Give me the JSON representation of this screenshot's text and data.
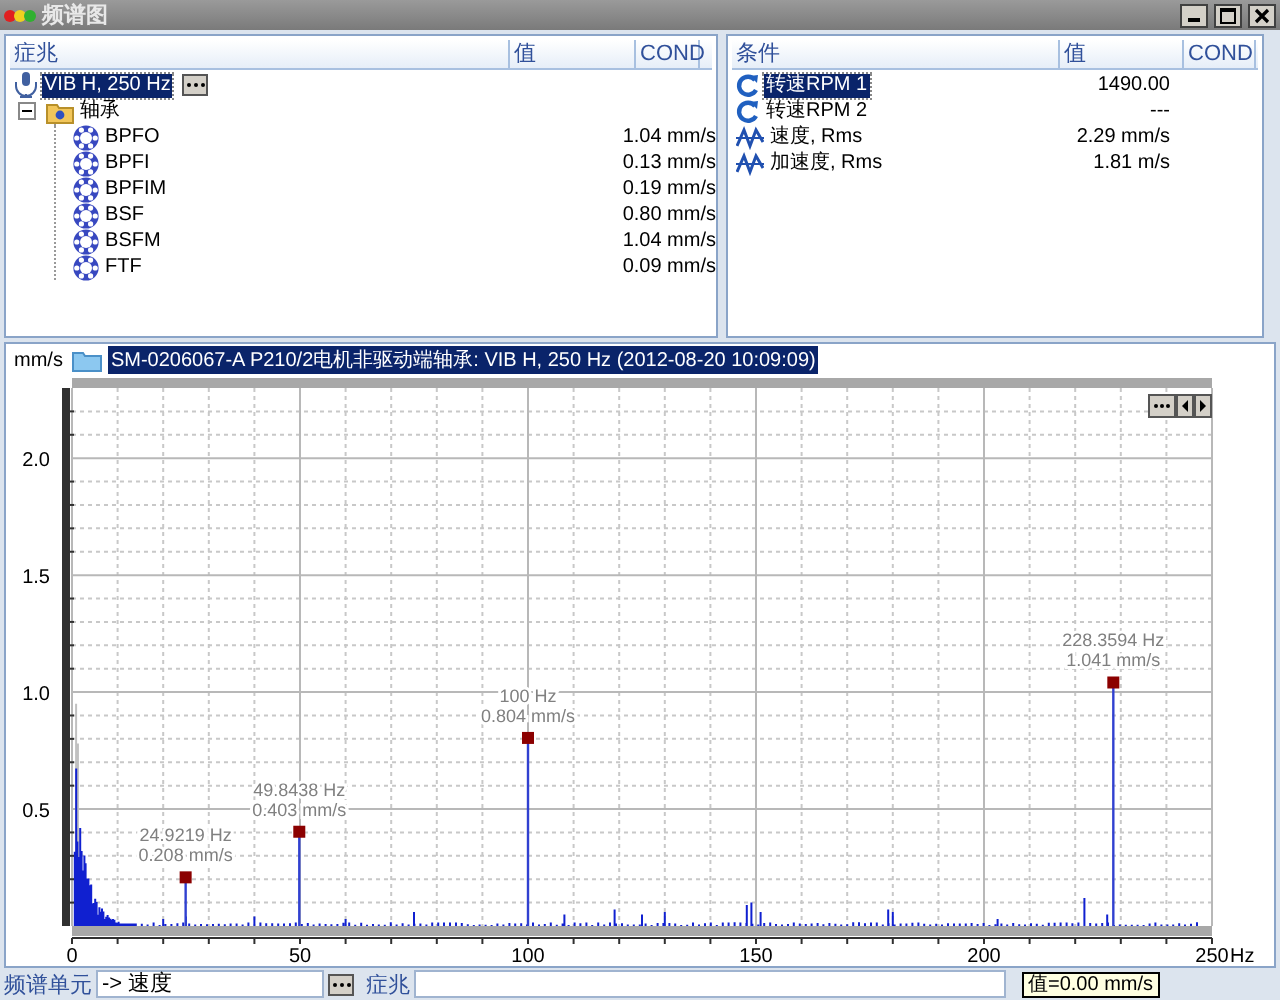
{
  "window": {
    "title": "频谱图"
  },
  "symptoms_panel": {
    "columns": [
      "症兆",
      "值",
      "COND"
    ],
    "root": {
      "label": "VIB H, 250 Hz",
      "selected": true,
      "children": [
        {
          "label": "轴承",
          "expanded": true,
          "children": [
            {
              "label": "BPFO",
              "value": "1.04 mm/s"
            },
            {
              "label": "BPFI",
              "value": "0.13 mm/s"
            },
            {
              "label": "BPFIM",
              "value": "0.19 mm/s"
            },
            {
              "label": "BSF",
              "value": "0.80 mm/s"
            },
            {
              "label": "BSFM",
              "value": "1.04 mm/s"
            },
            {
              "label": "FTF",
              "value": "0.09 mm/s"
            }
          ]
        }
      ]
    }
  },
  "conditions_panel": {
    "columns": [
      "条件",
      "值",
      "COND"
    ],
    "rows": [
      {
        "kind": "rpm",
        "label": "转速RPM 1",
        "value": "1490.00",
        "selected": true
      },
      {
        "kind": "rpm",
        "label": "转速RPM 2",
        "value": "---",
        "selected": false
      },
      {
        "kind": "wave",
        "label": "速度, Rms",
        "value": "2.29 mm/s",
        "selected": false
      },
      {
        "kind": "wave",
        "label": "加速度, Rms",
        "value": "1.81 m/s",
        "selected": false
      }
    ]
  },
  "spectrum": {
    "unit": "mm/s",
    "title": "SM-0206067-A  P210/2电机非驱动端轴承: VIB H, 250 Hz (2012-08-20 10:09:09)",
    "chart_data": {
      "type": "scatter",
      "grid": true,
      "xlabel": "Hz",
      "x": [
        24.9219,
        49.8438,
        100,
        228.3594
      ],
      "values": [
        0.208,
        0.403,
        0.804,
        1.041
      ],
      "xlim": [
        0,
        250
      ],
      "ylim": [
        0,
        2.3
      ],
      "xticks": [
        0,
        50,
        100,
        150,
        200,
        250
      ],
      "yticks": [
        {
          "value": 0.5,
          "label": "0.5"
        },
        {
          "value": 1,
          "label": "1.0"
        },
        {
          "value": 1.5,
          "label": "1.5"
        },
        {
          "value": 2,
          "label": "2.0"
        }
      ],
      "annotations": [
        {
          "x": 24.9219,
          "y": 0.208,
          "text": "24.9219 Hz\n0.208 mm/s"
        },
        {
          "x": 49.8438,
          "y": 0.403,
          "text": "49.8438 Hz\n0.403 mm/s"
        },
        {
          "x": 100,
          "y": 0.804,
          "text": "100 Hz\n0.804 mm/s"
        },
        {
          "x": 228.3594,
          "y": 1.041,
          "text": "228.3594 Hz\n1.041 mm/s"
        }
      ]
    }
  },
  "status_bar": {
    "unit_label": "频谱单元",
    "unit_value": "-> 速度",
    "symptom_label": "症兆",
    "tooltip": "值=0.00 mm/s"
  }
}
